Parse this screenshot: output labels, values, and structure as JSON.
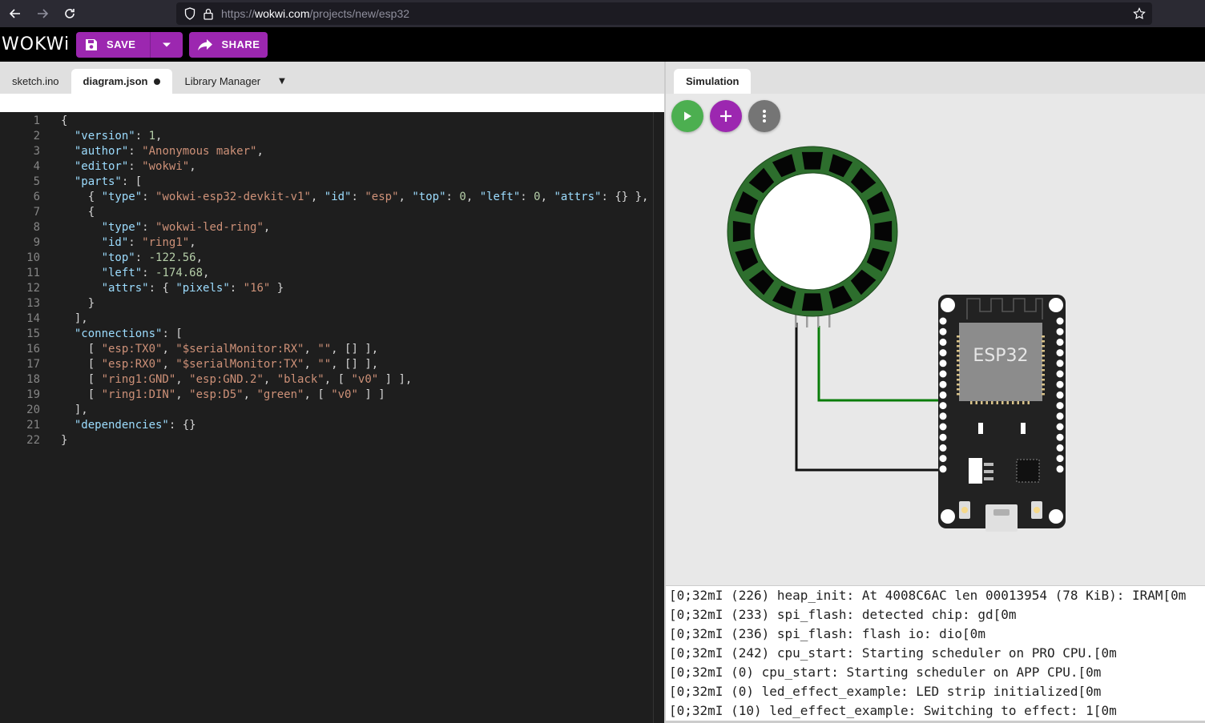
{
  "browser": {
    "url_scheme": "https://",
    "url_host": "wokwi.com",
    "url_path": "/projects/new/esp32"
  },
  "toolbar": {
    "logo": "WOKWi",
    "save_label": "SAVE",
    "share_label": "SHARE"
  },
  "editor": {
    "tabs": [
      {
        "label": "sketch.ino"
      },
      {
        "label": "diagram.json",
        "dirty": true
      },
      {
        "label": "Library Manager"
      }
    ],
    "code_lines": [
      "{",
      "  \"version\": 1,",
      "  \"author\": \"Anonymous maker\",",
      "  \"editor\": \"wokwi\",",
      "  \"parts\": [",
      "    { \"type\": \"wokwi-esp32-devkit-v1\", \"id\": \"esp\", \"top\": 0, \"left\": 0, \"attrs\": {} },",
      "    {",
      "      \"type\": \"wokwi-led-ring\",",
      "      \"id\": \"ring1\",",
      "      \"top\": -122.56,",
      "      \"left\": -174.68,",
      "      \"attrs\": { \"pixels\": \"16\" }",
      "    }",
      "  ],",
      "  \"connections\": [",
      "    [ \"esp:TX0\", \"$serialMonitor:RX\", \"\", [] ],",
      "    [ \"esp:RX0\", \"$serialMonitor:TX\", \"\", [] ],",
      "    [ \"ring1:GND\", \"esp:GND.2\", \"black\", [ \"v0\" ] ],",
      "    [ \"ring1:DIN\", \"esp:D5\", \"green\", [ \"v0\" ] ]",
      "  ],",
      "  \"dependencies\": {}",
      "}"
    ]
  },
  "simulation": {
    "tab_label": "Simulation",
    "chip_label": "ESP32",
    "led_ring_pixels": 16,
    "wire_colors": {
      "gnd": "#000000",
      "din": "#008000"
    }
  },
  "serial_monitor": {
    "lines": [
      "[0;32mI (226) heap_init: At 4008C6AC len 00013954 (78 KiB): IRAM[0m",
      "[0;32mI (233) spi_flash: detected chip: gd[0m",
      "[0;32mI (236) spi_flash: flash io: dio[0m",
      "[0;32mI (242) cpu_start: Starting scheduler on PRO CPU.[0m",
      "[0;32mI (0) cpu_start: Starting scheduler on APP CPU.[0m",
      "[0;32mI (0) led_effect_example: LED strip initialized[0m",
      "[0;32mI (10) led_effect_example: Switching to effect: 1[0m"
    ]
  },
  "colors": {
    "accent": "#9c27b0",
    "play": "#4caf50",
    "ring_segment": "#3b7a3b"
  }
}
